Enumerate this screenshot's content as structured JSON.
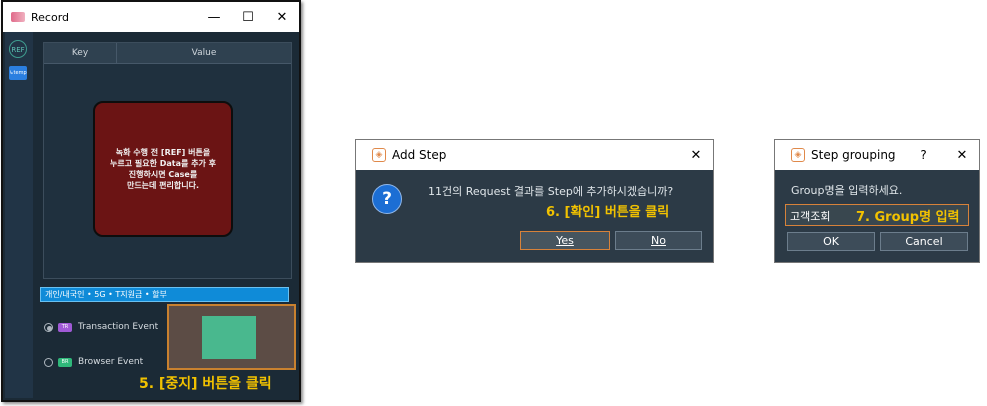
{
  "record_window": {
    "title": "Record",
    "controls": [
      "—",
      "☐",
      "✕"
    ],
    "side_icons": [
      "REF",
      "↳temp"
    ],
    "table": {
      "columns": [
        "Key",
        "Value"
      ]
    },
    "tip_text": "녹화 수행 전 [REF] 버튼을\n누르고 필요한 Data를 추가 후\n진행하시면 Case를\n만드는데 편리합니다.",
    "path_bar": "개인/내국인 • 5G • T지원금 • 할부",
    "events": [
      {
        "badge": "TR",
        "label": "Transaction Event",
        "selected": true,
        "badge_color": "#a05ad6"
      },
      {
        "badge": "BR",
        "label": "Browser Event",
        "selected": false,
        "badge_color": "#2fb87a"
      }
    ],
    "annotation": "5. [중지] 버튼을 클릭"
  },
  "add_step_dialog": {
    "title": "Add Step",
    "message": "11건의 Request 결과를 Step에 추가하시겠습니까?",
    "annotation": "6. [확인] 버튼을 클릭",
    "yes_label": "Yes",
    "no_label": "No"
  },
  "step_grouping_dialog": {
    "title": "Step grouping",
    "help": "?",
    "prompt": "Group명을 입력하세요.",
    "input_value": "고객조회",
    "annotation": "7. Group명 입력",
    "ok_label": "OK",
    "cancel_label": "Cancel"
  },
  "colors": {
    "dark_bg": "#2c3a46",
    "annotation": "#f2c200",
    "focus_border": "#d7823a"
  }
}
